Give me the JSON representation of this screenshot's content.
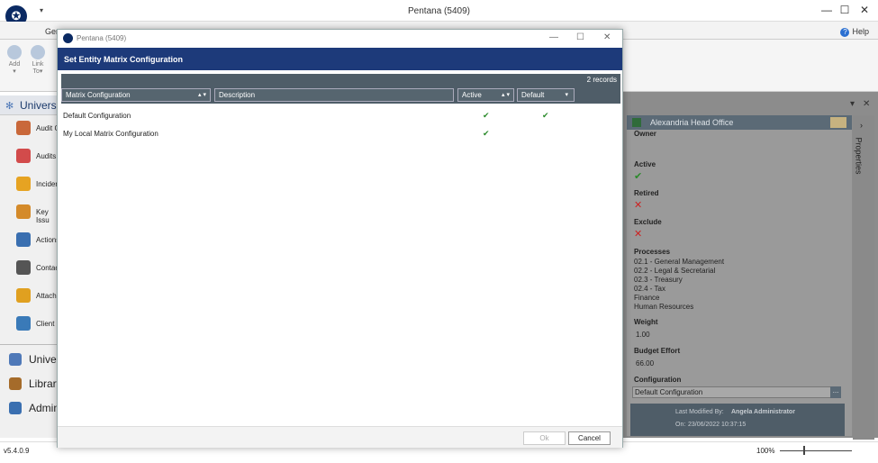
{
  "app": {
    "title": "Pentana (5409)",
    "version": "v5.4.0.9",
    "zoom": "100%"
  },
  "ribbon": {
    "tab": "Gen",
    "help": "Help",
    "buttons": [
      {
        "label": "Add",
        "sub": "▾"
      },
      {
        "label": "Link",
        "sub": "To▾"
      }
    ]
  },
  "nav": {
    "header": "Univers",
    "items": [
      {
        "label": "Audit C",
        "icon": "audit-icon",
        "color": "#c9683a"
      },
      {
        "label": "Audits",
        "icon": "audits-icon",
        "color": "#d24b4b"
      },
      {
        "label": "Inciden",
        "icon": "warning-icon",
        "color": "#e6a322"
      },
      {
        "label": "Key Issu",
        "icon": "key-icon",
        "color": "#d48a2a"
      },
      {
        "label": "Actions",
        "icon": "actions-icon",
        "color": "#3a6fb0"
      },
      {
        "label": "Contac",
        "icon": "contact-icon",
        "color": "#555"
      },
      {
        "label": "Attachr",
        "icon": "attachment-icon",
        "color": "#e0a020"
      },
      {
        "label": "Client D",
        "icon": "client-icon",
        "color": "#3a7ab8"
      }
    ],
    "sections": [
      {
        "label": "Univer",
        "icon": "universe-icon",
        "color": "#4f79b8"
      },
      {
        "label": "Library",
        "icon": "library-icon",
        "color": "#a56b2a"
      },
      {
        "label": "Admin",
        "icon": "admin-icon",
        "color": "#3a6fb0"
      }
    ]
  },
  "props": {
    "entity": "Alexandria Head Office",
    "tab": "Properties",
    "owner": "Owner",
    "active_label": "Active",
    "active_value": "✔",
    "retired_label": "Retired",
    "retired_value": "✕",
    "exclude_label": "Exclude",
    "exclude_value": "✕",
    "processes_label": "Processes",
    "processes": [
      "02.1 - General Management",
      "02.2 - Legal & Secretarial",
      "02.3 - Treasury",
      "02.4 - Tax",
      "Finance",
      "Human Resources"
    ],
    "weight_label": "Weight",
    "weight_value": "1.00",
    "budget_label": "Budget Effort",
    "budget_value": "66.00",
    "config_label": "Configuration",
    "config_value": "Default Configuration",
    "modified_by_label": "Last Modified By:",
    "modified_by": "Angela Administrator",
    "modified_on_label": "On:",
    "modified_on": "23/06/2022 10:37:15"
  },
  "dialog": {
    "window_title": "Pentana (5409)",
    "header": "Set Entity Matrix Configuration",
    "records": "2 records",
    "columns": {
      "name": "Matrix Configuration",
      "description": "Description",
      "active": "Active",
      "default": "Default"
    },
    "rows": [
      {
        "name": "Default Configuration",
        "active": "✔",
        "default": "✔"
      },
      {
        "name": "My Local Matrix Configuration",
        "active": "✔",
        "default": ""
      }
    ],
    "ok": "Ok",
    "cancel": "Cancel"
  }
}
